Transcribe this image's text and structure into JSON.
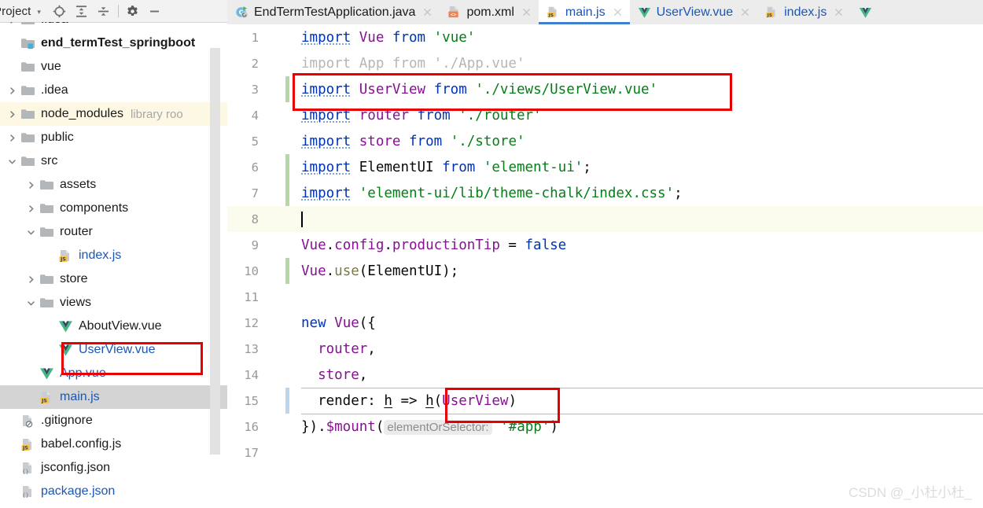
{
  "toolwindow": {
    "title": "Project",
    "caret_icon": "chevron-down-icon",
    "buttons": [
      {
        "name": "locate-icon",
        "tooltip": "Select Opened File"
      },
      {
        "name": "expand-all-icon",
        "tooltip": "Expand All"
      },
      {
        "name": "collapse-all-icon",
        "tooltip": "Collapse All"
      },
      {
        "name": "settings-gear-icon",
        "tooltip": "Settings"
      },
      {
        "name": "hide-minimize-icon",
        "tooltip": "Hide"
      }
    ]
  },
  "tree": [
    {
      "label": ".idea",
      "indent": 0,
      "arrow": "right",
      "icon": "folder",
      "style": "normal",
      "clipped_top": true
    },
    {
      "label": "end_termTest_springboot",
      "indent": 0,
      "arrow": "none",
      "icon": "module",
      "style": "bold"
    },
    {
      "label": "vue",
      "indent": 0,
      "arrow": "none",
      "icon": "folder",
      "style": "normal"
    },
    {
      "label": ".idea",
      "indent": 0,
      "arrow": "right",
      "icon": "folder",
      "style": "normal"
    },
    {
      "label": "node_modules",
      "indent": 0,
      "arrow": "right",
      "icon": "folder",
      "style": "normal",
      "tag": "library roo",
      "highlight": "library"
    },
    {
      "label": "public",
      "indent": 0,
      "arrow": "right",
      "icon": "folder",
      "style": "normal"
    },
    {
      "label": "src",
      "indent": 0,
      "arrow": "down",
      "icon": "folder",
      "style": "normal"
    },
    {
      "label": "assets",
      "indent": 1,
      "arrow": "right",
      "icon": "folder",
      "style": "normal"
    },
    {
      "label": "components",
      "indent": 1,
      "arrow": "right",
      "icon": "folder",
      "style": "normal"
    },
    {
      "label": "router",
      "indent": 1,
      "arrow": "down",
      "icon": "folder",
      "style": "normal"
    },
    {
      "label": "index.js",
      "indent": 2,
      "arrow": "none",
      "icon": "js",
      "style": "blue"
    },
    {
      "label": "store",
      "indent": 1,
      "arrow": "right",
      "icon": "folder",
      "style": "normal"
    },
    {
      "label": "views",
      "indent": 1,
      "arrow": "down",
      "icon": "folder",
      "style": "normal"
    },
    {
      "label": "AboutView.vue",
      "indent": 2,
      "arrow": "none",
      "icon": "vue",
      "style": "normal"
    },
    {
      "label": "UserView.vue",
      "indent": 2,
      "arrow": "none",
      "icon": "vue",
      "style": "blue",
      "boxed": true
    },
    {
      "label": "App.vue",
      "indent": 1,
      "arrow": "none",
      "icon": "vue",
      "style": "blue"
    },
    {
      "label": "main.js",
      "indent": 1,
      "arrow": "none",
      "icon": "js",
      "style": "blue",
      "selected": true
    },
    {
      "label": ".gitignore",
      "indent": 0,
      "arrow": "none",
      "icon": "gitignore",
      "style": "normal"
    },
    {
      "label": "babel.config.js",
      "indent": 0,
      "arrow": "none",
      "icon": "js",
      "style": "normal"
    },
    {
      "label": "jsconfig.json",
      "indent": 0,
      "arrow": "none",
      "icon": "json",
      "style": "normal"
    },
    {
      "label": "package.json",
      "indent": 0,
      "arrow": "none",
      "icon": "json",
      "style": "blue"
    }
  ],
  "tabs": [
    {
      "label": "EndTermTestApplication.java",
      "icon": "java-class-icon",
      "active": false,
      "closable": true
    },
    {
      "label": "pom.xml",
      "icon": "maven-xml-icon",
      "active": false,
      "closable": true
    },
    {
      "label": "main.js",
      "icon": "js-file-icon",
      "active": true,
      "closable": true
    },
    {
      "label": "UserView.vue",
      "icon": "vue-file-icon",
      "active": false,
      "closable": true
    },
    {
      "label": "index.js",
      "icon": "js-file-icon",
      "active": false,
      "closable": true
    }
  ],
  "editor": {
    "file": "main.js",
    "lines": [
      {
        "n": "1",
        "change": "none",
        "caret": false
      },
      {
        "n": "2",
        "change": "none",
        "caret": false
      },
      {
        "n": "3",
        "change": "green",
        "caret": false
      },
      {
        "n": "4",
        "change": "none",
        "caret": false
      },
      {
        "n": "5",
        "change": "none",
        "caret": false
      },
      {
        "n": "6",
        "change": "green",
        "caret": false
      },
      {
        "n": "7",
        "change": "green",
        "caret": false
      },
      {
        "n": "8",
        "change": "none",
        "caret": true
      },
      {
        "n": "9",
        "change": "none",
        "caret": false
      },
      {
        "n": "10",
        "change": "green",
        "caret": false
      },
      {
        "n": "11",
        "change": "none",
        "caret": false
      },
      {
        "n": "12",
        "change": "none",
        "caret": false
      },
      {
        "n": "13",
        "change": "none",
        "caret": false
      },
      {
        "n": "14",
        "change": "none",
        "caret": false
      },
      {
        "n": "15",
        "change": "blue",
        "caret": false
      },
      {
        "n": "16",
        "change": "none",
        "caret": false
      },
      {
        "n": "17",
        "change": "none",
        "caret": false
      }
    ],
    "code": {
      "l1": "import Vue from 'vue'",
      "l2": "import App from './App.vue'",
      "l3": "import UserView from './views/UserView.vue'",
      "l4": "import router from './router'",
      "l5": "import store from './store'",
      "l6": "import ElementUI from 'element-ui';",
      "l7": "import 'element-ui/lib/theme-chalk/index.css';",
      "l8": "",
      "l9": "Vue.config.productionTip = false",
      "l10": "Vue.use(ElementUI);",
      "l11": "",
      "l12": "new Vue({",
      "l13": "  router,",
      "l14": "  store,",
      "l15": "  render: h => h(UserView)",
      "l16": "}).$mount('#app')",
      "l17": ""
    },
    "param_hint": "elementOrSelector:"
  },
  "annotations": {
    "box_import_line": "import UserView from './views/UserView.vue'",
    "box_render_call": "h(UserView)",
    "box_tree_file": "UserView.vue",
    "color": "#e60000"
  },
  "watermark": "CSDN @_小杜小杜_"
}
